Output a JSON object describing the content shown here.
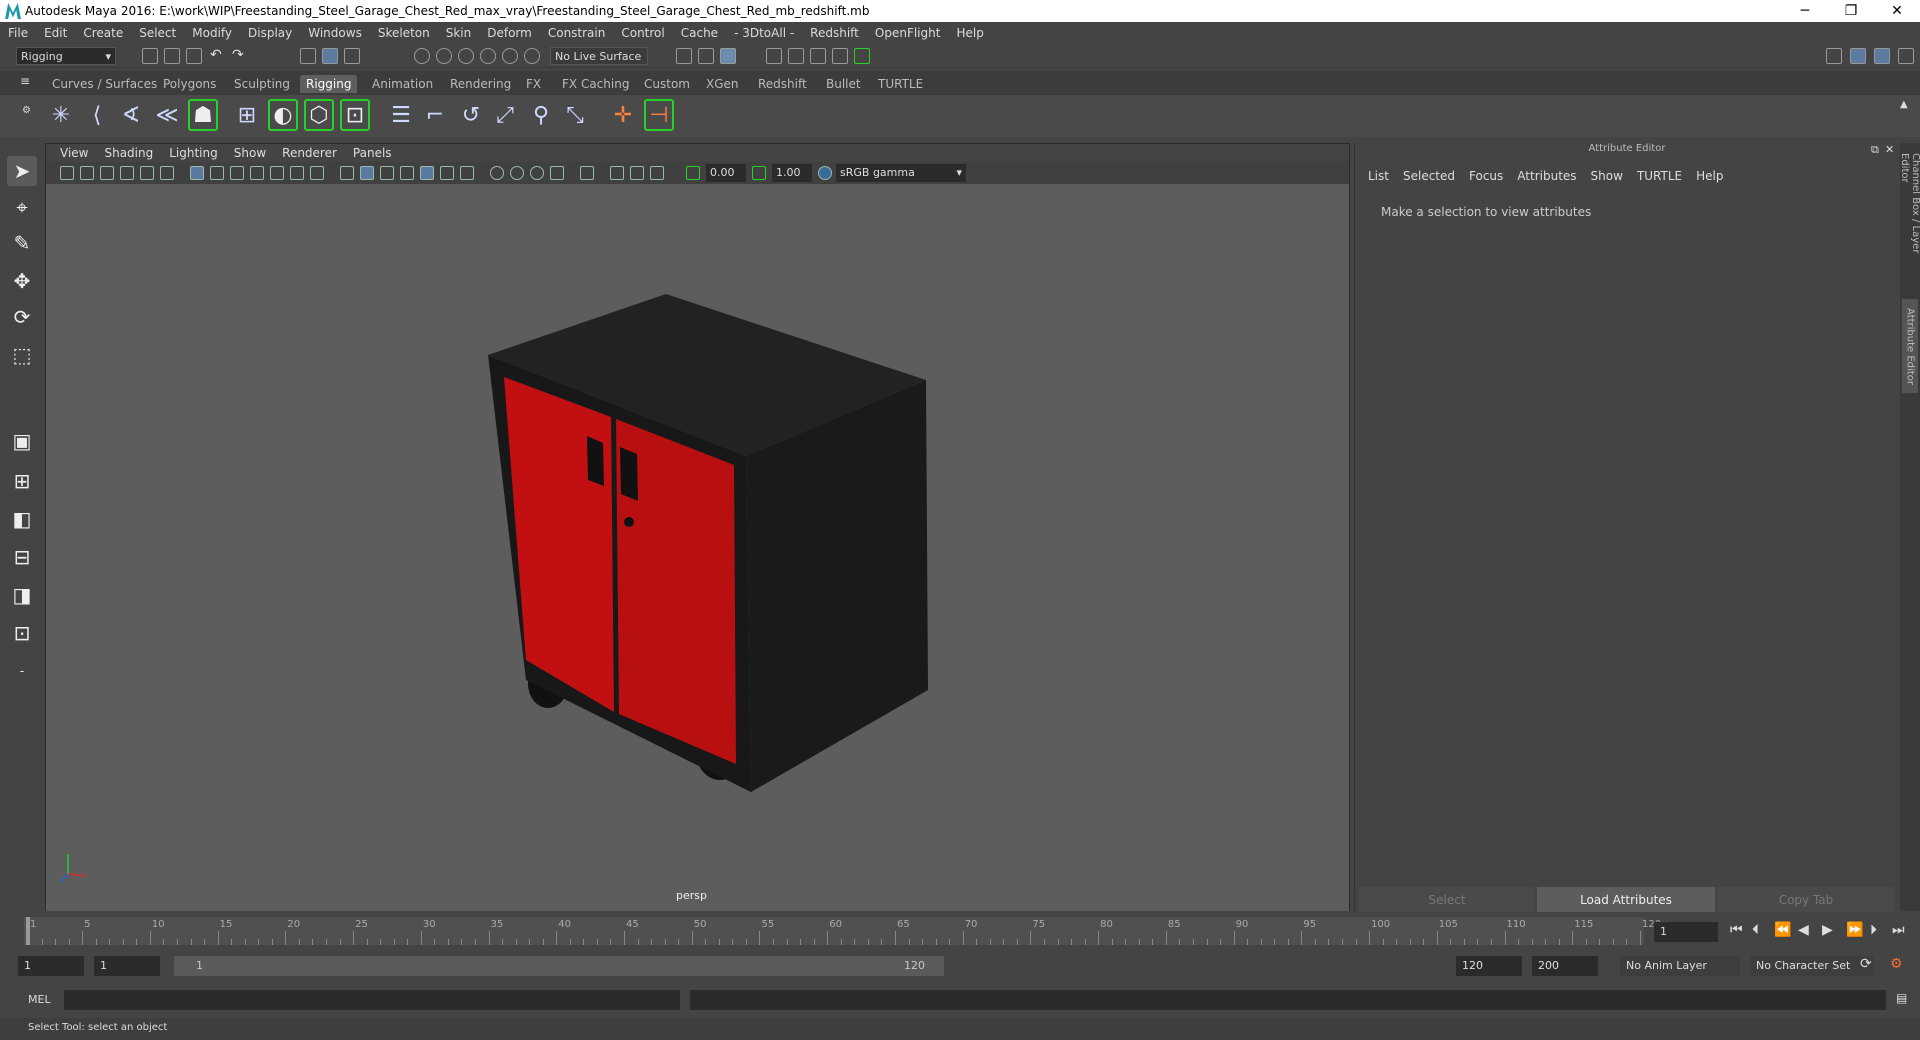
{
  "window": {
    "title": "Autodesk Maya 2016: E:\\work\\WIP\\Freestanding_Steel_Garage_Chest_Red_max_vray\\Freestanding_Steel_Garage_Chest_Red_mb_redshift.mb",
    "minimize": "─",
    "maximize": "❐",
    "close": "✕"
  },
  "menubar": [
    "File",
    "Edit",
    "Create",
    "Select",
    "Modify",
    "Display",
    "Windows",
    "Skeleton",
    "Skin",
    "Deform",
    "Constrain",
    "Control",
    "Cache",
    "- 3DtoAll -",
    "Redshift",
    "OpenFlight",
    "Help"
  ],
  "statusline": {
    "mode": "Rigging",
    "live_surface": "No Live Surface"
  },
  "shelf_tabs": [
    "Curves / Surfaces",
    "Polygons",
    "Sculpting",
    "Rigging",
    "Animation",
    "Rendering",
    "FX",
    "FX Caching",
    "Custom",
    "XGen",
    "Redshift",
    "Bullet",
    "TURTLE"
  ],
  "shelf_active": "Rigging",
  "panel": {
    "menus": [
      "View",
      "Shading",
      "Lighting",
      "Show",
      "Renderer",
      "Panels"
    ],
    "exposure": "0.00",
    "gamma": "1.00",
    "color_space": "sRGB gamma",
    "camera_label": "persp"
  },
  "attribute_editor": {
    "header": "Attribute Editor",
    "menus": [
      "List",
      "Selected",
      "Focus",
      "Attributes",
      "Show",
      "TURTLE",
      "Help"
    ],
    "message": "Make a selection to view attributes",
    "buttons": {
      "select": "Select",
      "load": "Load Attributes",
      "copy_tab": "Copy Tab"
    }
  },
  "side_tabs": {
    "channel_box": "Channel Box / Layer Editor",
    "attribute_editor": "Attribute Editor"
  },
  "timeline": {
    "labels": [
      "1",
      "5",
      "10",
      "15",
      "20",
      "25",
      "30",
      "35",
      "40",
      "45",
      "50",
      "55",
      "60",
      "65",
      "70",
      "75",
      "80",
      "85",
      "90",
      "95",
      "100",
      "105",
      "110",
      "115",
      "120"
    ],
    "current_frame": "1"
  },
  "range": {
    "start": "1",
    "playback_start": "1",
    "slider_start": "1",
    "slider_end": "120",
    "playback_end": "120",
    "end": "200",
    "anim_layer": "No Anim Layer",
    "character_set": "No Character Set"
  },
  "command_line": {
    "lang": "MEL"
  },
  "help_line": "Select Tool: select an object",
  "colors": {
    "cabinet_red": "#c21012",
    "cabinet_body": "#1c1c1c",
    "viewport_bg": "#5d5d5d",
    "shelf_highlight": "#27d127"
  }
}
